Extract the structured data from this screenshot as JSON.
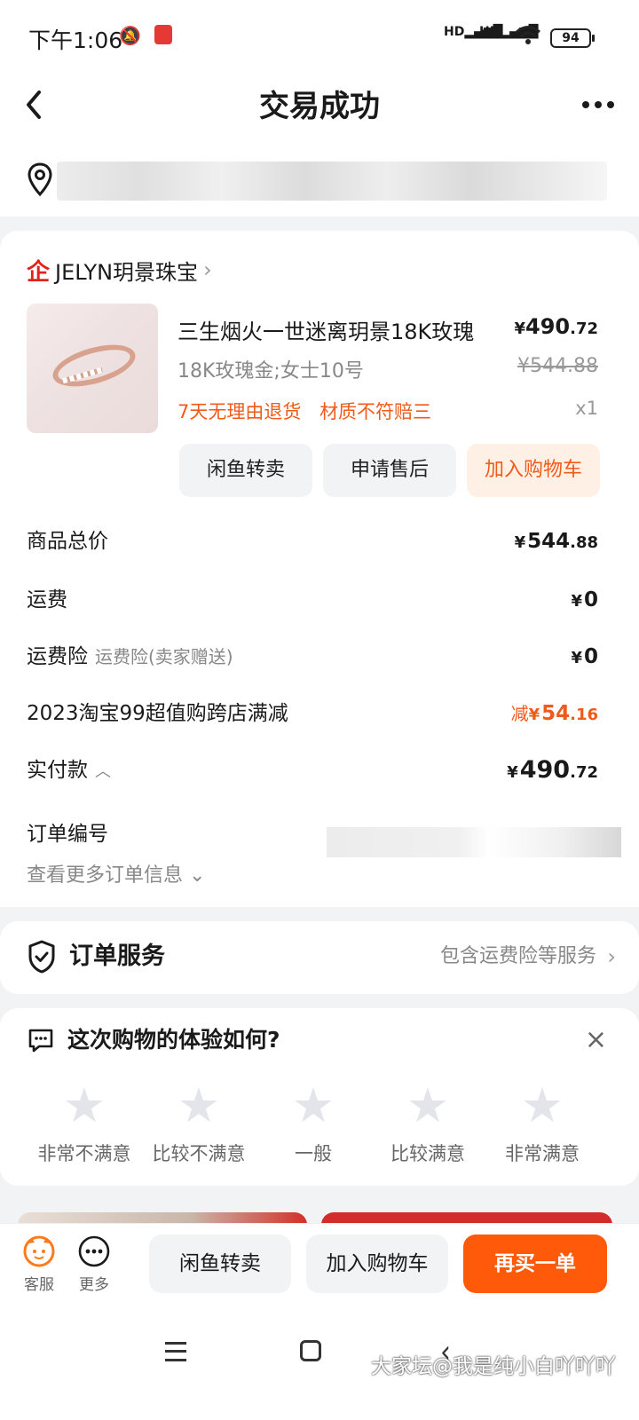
{
  "status_bar": {
    "time": "下午1:06",
    "signal_1": "HD",
    "signal_2": "HD",
    "battery": "94"
  },
  "header": {
    "back_icon": "back-arrow-icon",
    "title": "交易成功",
    "more_icon": "more-dots-icon"
  },
  "address": {
    "icon": "location-pin-icon"
  },
  "shop": {
    "icon_text": "企",
    "name": "JELYN玥景珠宝",
    "arrow": "›"
  },
  "product": {
    "title": "三生烟火一世迷离玥景18K玫瑰",
    "price_currency": "¥",
    "price_int": "490",
    "price_dec": ".72",
    "sku": "18K玫瑰金;女士10号",
    "original_price": "¥544.88",
    "tags": [
      "7天无理由退货",
      "材质不符赔三"
    ],
    "quantity": "x1",
    "buttons": [
      "闲鱼转卖",
      "申请售后",
      "加入购物车"
    ]
  },
  "summary": {
    "rows": [
      {
        "label": "商品总价",
        "sub": "",
        "currency": "¥",
        "int": "544",
        "dec": ".88"
      },
      {
        "label": "运费",
        "sub": "",
        "currency": "¥",
        "int": "0",
        "dec": ""
      },
      {
        "label": "运费险",
        "sub": "运费险(卖家赠送)",
        "currency": "¥",
        "int": "0",
        "dec": ""
      },
      {
        "label": "2023淘宝99超值购跨店满减",
        "sub": "",
        "prefix": "减",
        "currency": "¥",
        "int": "54",
        "dec": ".16"
      },
      {
        "label": "实付款",
        "sub": "",
        "currency": "¥",
        "int": "490",
        "dec": ".72"
      }
    ],
    "order_no_label": "订单编号",
    "more_info": "查看更多订单信息 ⌄"
  },
  "service": {
    "title": "订单服务",
    "desc": "包含运费险等服务",
    "arrow": "›"
  },
  "rating": {
    "title": "这次购物的体验如何?",
    "close": "×",
    "levels": [
      "非常不满意",
      "比较不满意",
      "一般",
      "比较满意",
      "非常满意"
    ]
  },
  "bottom_bar": {
    "service_label": "客服",
    "more_label": "更多",
    "buttons": [
      "闲鱼转卖",
      "加入购物车",
      "再买一单"
    ]
  },
  "watermark": "大家坛@我是纯小白吖吖吖",
  "colors": {
    "accent": "#ff5a0a",
    "discount": "#f05a1a",
    "shop_logo": "#e0241c"
  }
}
